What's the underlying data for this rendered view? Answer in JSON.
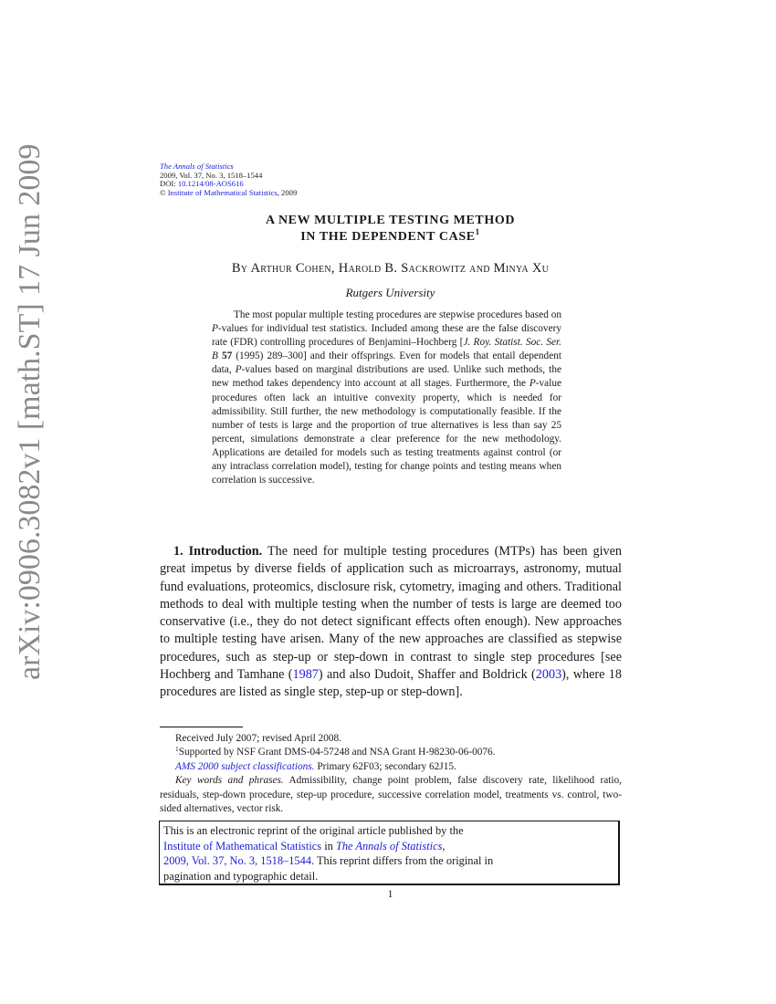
{
  "arxiv_stamp": "arXiv:0906.3082v1  [math.ST]  17 Jun 2009",
  "journal_header": {
    "journal_name": "The Annals of Statistics",
    "volume_line": "2009, Vol. 37, No. 3, 1518–1544",
    "doi_label": "DOI: ",
    "doi": "10.1214/08-AOS616",
    "copyright_symbol": "©",
    "publisher": "Institute of Mathematical Statistics",
    "copyright_year": ", 2009"
  },
  "title": {
    "line1": "A NEW MULTIPLE TESTING METHOD",
    "line2": "IN THE DEPENDENT CASE",
    "footnote_mark": "1"
  },
  "authors": "By Arthur Cohen, Harold B. Sackrowitz and Minya Xu",
  "affiliation": "Rutgers University",
  "abstract": {
    "seg1": "The most popular multiple testing procedures are stepwise procedures based on ",
    "p1": "P",
    "seg2": "-values for individual test statistics. Included among these are the false discovery rate (FDR) controlling procedures of Benjamini–Hochberg [",
    "journal_ref": "J. Roy. Statist. Soc. Ser. B",
    "volume": "57",
    "seg3": " (1995) 289–300] and their offsprings. Even for models that entail dependent data, ",
    "p2": "P",
    "seg4": "-values based on marginal distributions are used. Unlike such methods, the new method takes dependency into account at all stages. Furthermore, the ",
    "p3": "P",
    "seg5": "-value procedures often lack an intuitive convexity property, which is needed for admissibility. Still further, the new methodology is computationally feasible. If the number of tests is large and the proportion of true alternatives is less than say 25 percent, simulations demonstrate a clear preference for the new methodology. Applications are detailed for models such as testing treatments against control (or any intraclass correlation model), testing for change points and testing means when correlation is successive."
  },
  "introduction": {
    "heading": "1. Introduction.",
    "seg1": " The need for multiple testing procedures (MTPs) has been given great impetus by diverse fields of application such as microarrays, astronomy, mutual fund evaluations, proteomics, disclosure risk, cytometry, imaging and others. Traditional methods to deal with multiple testing when the number of tests is large are deemed too conservative (i.e., they do not detect significant effects often enough). New approaches to multiple testing have arisen. Many of the new approaches are classified as stepwise procedures, such as step-up or step-down in contrast to single step procedures [see Hochberg and Tamhane (",
    "cite1": "1987",
    "seg2": ") and also Dudoit, Shaffer and Boldrick (",
    "cite2": "2003",
    "seg3": "), where 18 procedures are listed as single step, step-up or step-down]."
  },
  "footnotes": {
    "received": "Received July 2007; revised April 2008.",
    "support_mark": "1",
    "support": "Supported by NSF Grant DMS-04-57248 and NSA Grant H-98230-06-0076.",
    "ams_label": "AMS 2000 subject classifications.",
    "ams_text": " Primary 62F03; secondary 62J15.",
    "keywords_label": "Key words and phrases.",
    "keywords_text": " Admissibility, change point problem, false discovery rate, likelihood ratio, residuals, step-down procedure, step-up procedure, successive correlation model, treatments vs. control, two-sided alternatives, vector risk."
  },
  "reprint_box": {
    "line1": "This is an electronic reprint of the original article published by the",
    "publisher_link": "Institute of Mathematical Statistics",
    "in_text": " in ",
    "journal_link": "The Annals of Statistics",
    "comma": ",",
    "citation_link": "2009, Vol. 37, No. 3, 1518–1544",
    "line3_rest": ". This reprint differs from the original in",
    "line4": "pagination and typographic detail."
  },
  "page_number": "1",
  "colors": {
    "link": "#2020d8",
    "stamp": "#8a8a8a",
    "text": "#1a1a1a"
  }
}
